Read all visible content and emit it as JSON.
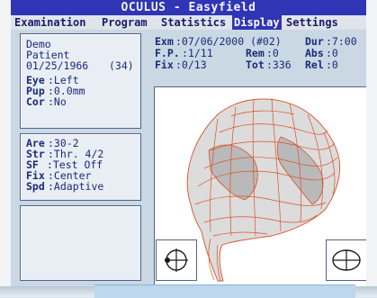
{
  "window": {
    "title": "OCULUS - Easyfield"
  },
  "menu": [
    {
      "label": "Examination",
      "active": false
    },
    {
      "label": "Program",
      "active": false
    },
    {
      "label": "Statistics",
      "active": false
    },
    {
      "label": "Display",
      "active": true
    },
    {
      "label": "Settings",
      "active": false
    }
  ],
  "patient": {
    "first_name": "Demo",
    "last_name": "Patient",
    "dob": "01/25/1966",
    "age": "(34)",
    "eye_label": "Eye",
    "eye_value": ":Left",
    "pup_label": "Pup",
    "pup_value": ":0.0mm",
    "cor_label": "Cor",
    "cor_value": ":No"
  },
  "program": {
    "are_label": "Are",
    "are_value": ":30-2",
    "str_label": "Str",
    "str_value": ":Thr. 4/2",
    "sf_label": "SF",
    "sf_value": " :Test Off",
    "fix_label": "Fix",
    "fix_value": ":Center",
    "spd_label": "Spd",
    "spd_value": ":Adaptive"
  },
  "exam": {
    "exm_label": "Exm",
    "exm_value": ":07/06/2000 (#02)",
    "dur_label": "Dur",
    "dur_value": ":7:00",
    "fp_label": "F.P.",
    "fp_value": ":1/11",
    "rem_label": "Rem",
    "rem_value": ":0",
    "abs_label": "Abs",
    "abs_value": ":0",
    "fix_label": "Fix",
    "fix_value": ":0/13",
    "tot_label": "Tot",
    "tot_value": ":336",
    "rel_label": "Rel",
    "rel_value": ":0"
  },
  "colors": {
    "title_bg": "#2f35b5",
    "mesh": "#d9532a",
    "mesh_fill": "#d8d8d8"
  },
  "icons": {
    "left_view": "crosshair-view-icon",
    "right_view": "target-view-icon"
  }
}
